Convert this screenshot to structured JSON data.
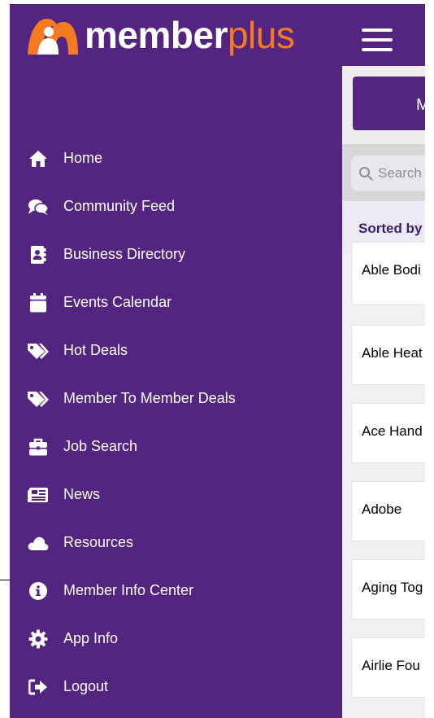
{
  "brand": {
    "name_main": "member",
    "name_accent": "plus",
    "accent_color": "#f47b20",
    "drawer_color": "#532580"
  },
  "nav": [
    {
      "label": "Home",
      "icon": "home-icon"
    },
    {
      "label": "Community Feed",
      "icon": "comments-icon"
    },
    {
      "label": "Business Directory",
      "icon": "address-book-icon"
    },
    {
      "label": "Events Calendar",
      "icon": "calendar-icon"
    },
    {
      "label": "Hot Deals",
      "icon": "tags-icon"
    },
    {
      "label": "Member To Member Deals",
      "icon": "tags-icon"
    },
    {
      "label": "Job Search",
      "icon": "briefcase-icon"
    },
    {
      "label": "News",
      "icon": "newspaper-icon"
    },
    {
      "label": "Resources",
      "icon": "cloud-icon"
    },
    {
      "label": "Member Info Center",
      "icon": "info-circle-icon"
    },
    {
      "label": "App Info",
      "icon": "cog-icon"
    },
    {
      "label": "Logout",
      "icon": "sign-out-icon"
    }
  ],
  "content": {
    "button_label": "M",
    "search_placeholder": "Search",
    "sorted_label": "Sorted by",
    "items": [
      "Able Bodi",
      "Able Heat",
      "Ace Hand",
      "Adobe",
      "Aging Tog",
      "Airlie Fou"
    ]
  }
}
